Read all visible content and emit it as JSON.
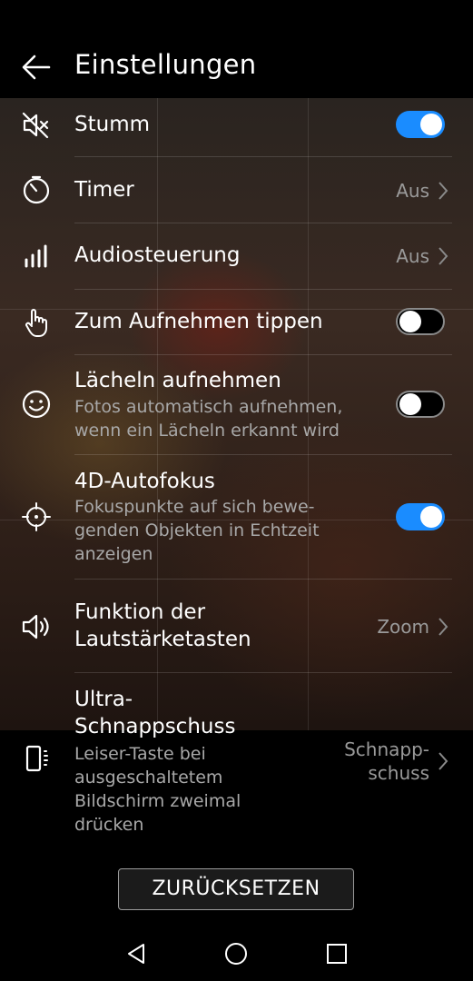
{
  "header": {
    "title": "Einstellungen"
  },
  "settings": [
    {
      "label": "Stumm",
      "toggle": "on",
      "icon": "mute-icon"
    },
    {
      "label": "Timer",
      "value": "Aus",
      "icon": "timer-icon"
    },
    {
      "label": "Audiosteuerung",
      "value": "Aus",
      "icon": "audio-control-icon"
    },
    {
      "label": "Zum Aufnehmen tippen",
      "toggle": "off",
      "icon": "tap-hand-icon"
    },
    {
      "label": "Lächeln aufnehmen",
      "sub1": "Fotos automatisch aufnehmen,",
      "sub2": "wenn ein Lächeln erkannt wird",
      "toggle": "off",
      "icon": "smile-icon"
    },
    {
      "label": "4D-Autofokus",
      "sub1": "Fokuspunkte auf sich bewe-",
      "sub2": "genden Objekten in Echtzeit",
      "sub3": "anzeigen",
      "toggle": "on",
      "icon": "focus-target-icon"
    },
    {
      "label1": "Funktion der",
      "label2": "Lautstärketasten",
      "value": "Zoom",
      "icon": "volume-icon"
    },
    {
      "label1": "Ultra-",
      "label2": "Schnappschuss",
      "sub1": "Leiser-Taste bei",
      "sub2": "ausgeschaltetem",
      "sub3": "Bildschirm zweimal",
      "sub4": "drücken",
      "value1": "Schnapp-",
      "value2": "schuss",
      "icon": "phone-snapshot-icon"
    }
  ],
  "reset_label": "ZURÜCKSETZEN",
  "colors": {
    "accent": "#1a8cff",
    "secondary_text": "#a8a8a8"
  }
}
